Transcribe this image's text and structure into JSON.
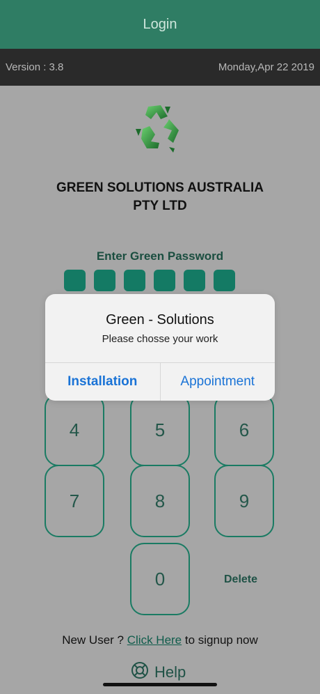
{
  "header": {
    "title": "Login"
  },
  "infobar": {
    "version": "Version : 3.8",
    "date": "Monday,Apr 22 2019"
  },
  "company": {
    "line1": "GREEN SOLUTIONS AUSTRALIA",
    "line2": "PTY LTD"
  },
  "password": {
    "label": "Enter Green Password",
    "digits_count": 6
  },
  "keypad": {
    "k4": "4",
    "k5": "5",
    "k6": "6",
    "k7": "7",
    "k8": "8",
    "k9": "9",
    "k0": "0",
    "delete": "Delete"
  },
  "signup": {
    "prefix": "New User ? ",
    "link": "Click Here",
    "suffix": " to signup now"
  },
  "help": {
    "label": "Help"
  },
  "dialog": {
    "title": "Green - Solutions",
    "message": "Please chosse your work",
    "primary_action": "Installation",
    "secondary_action": "Appointment"
  },
  "colors": {
    "header": "#2f7d64",
    "infobar": "#2a2a2a",
    "accent": "#147a64",
    "dialog_button": "#1a73d6"
  }
}
